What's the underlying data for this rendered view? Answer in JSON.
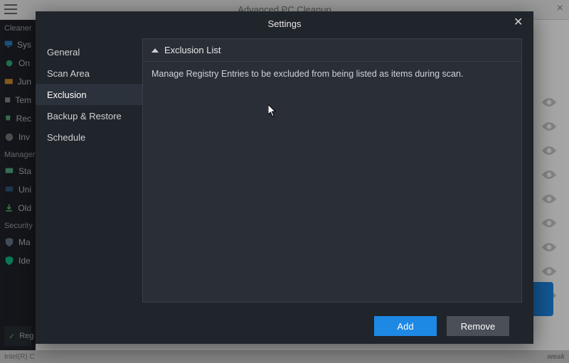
{
  "titlebar": {
    "app_title": "Advanced PC Cleanup"
  },
  "bg_sidebar": {
    "section_cleaner": "Cleaner",
    "section_manager": "Manager",
    "section_security": "Security",
    "items_cleaner": [
      {
        "label": "Sys"
      },
      {
        "label": "On"
      },
      {
        "label": "Jun"
      },
      {
        "label": "Tem"
      },
      {
        "label": "Rec"
      },
      {
        "label": "Inv"
      }
    ],
    "items_manager": [
      {
        "label": "Sta"
      },
      {
        "label": "Uni"
      },
      {
        "label": "Old"
      }
    ],
    "items_security": [
      {
        "label": "Ma"
      },
      {
        "label": "Ide"
      }
    ],
    "scan_now": "Reg"
  },
  "statusbar": {
    "left": "Intel(R) C",
    "brand": "weak"
  },
  "modal": {
    "title": "Settings",
    "nav": [
      {
        "key": "general",
        "label": "General",
        "active": false
      },
      {
        "key": "scan-area",
        "label": "Scan Area",
        "active": false
      },
      {
        "key": "exclusion",
        "label": "Exclusion",
        "active": true
      },
      {
        "key": "backup-restore",
        "label": "Backup & Restore",
        "active": false
      },
      {
        "key": "schedule",
        "label": "Schedule",
        "active": false
      }
    ],
    "panel": {
      "title": "Exclusion List",
      "description": "Manage Registry Entries to be excluded from being listed as items during scan."
    },
    "buttons": {
      "add": "Add",
      "remove": "Remove"
    }
  }
}
